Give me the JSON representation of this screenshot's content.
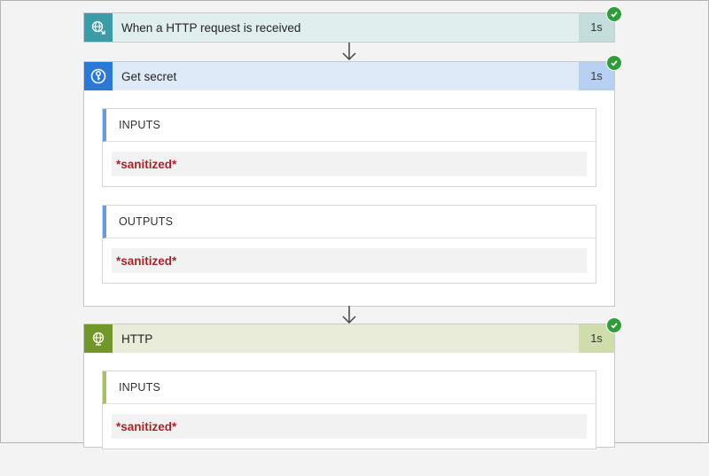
{
  "steps": {
    "trigger": {
      "title": "When a HTTP request is received",
      "duration": "1s",
      "icon": "http-request-trigger-icon",
      "color": "#3a9ca8",
      "header_bg": "#e0eeee",
      "duration_bg": "#c3dcdc"
    },
    "get_secret": {
      "title": "Get secret",
      "duration": "1s",
      "icon": "key-vault-icon",
      "color": "#2b79d6",
      "header_bg": "#dfeaf8",
      "duration_bg": "#b7cff0",
      "sections": [
        {
          "label": "INPUTS",
          "value": "*sanitized*"
        },
        {
          "label": "OUTPUTS",
          "value": "*sanitized*"
        }
      ]
    },
    "http": {
      "title": "HTTP",
      "duration": "1s",
      "icon": "globe-icon",
      "color": "#709727",
      "header_bg": "#e8ecd9",
      "duration_bg": "#cfdcab",
      "sections": [
        {
          "label": "INPUTS",
          "value": "*sanitized*"
        }
      ]
    }
  },
  "status_color": "#2f9e3a",
  "value_color": "#a4262c"
}
